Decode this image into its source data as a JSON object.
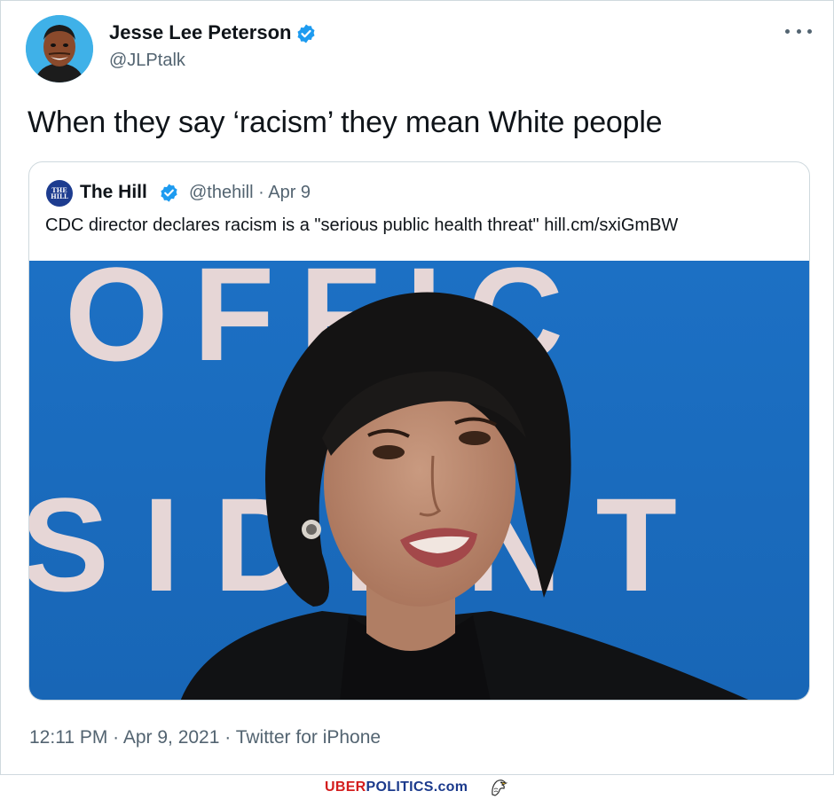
{
  "tweet": {
    "author_name": "Jesse Lee Peterson",
    "author_handle": "@JLPtalk",
    "more_icon": "more-dots-icon",
    "text": "When they say ‘racism’ they mean White people",
    "timestamp": "12:11 PM · Apr 9, 2021 · Twitter for iPhone"
  },
  "quoted_tweet": {
    "avatar_text": "THE HILL",
    "author_name": "The Hill",
    "author_handle": "@thehill",
    "meta": "@thehill · Apr 9",
    "text": "CDC director declares racism is a \"serious public health threat\" hill.cm/sxiGmBW",
    "image_background_text": "OFFIC SIDENT"
  },
  "watermark": {
    "brand_red": "UBER",
    "brand_blue": "POLITICS.com"
  },
  "colors": {
    "verified_blue": "#1d9bf0",
    "text_primary": "#0f1419",
    "text_secondary": "#536471",
    "border": "#cfd9de",
    "photo_background": "#1d6fc2",
    "watermark_red": "#d31d1d",
    "watermark_blue": "#1b3a8c"
  }
}
